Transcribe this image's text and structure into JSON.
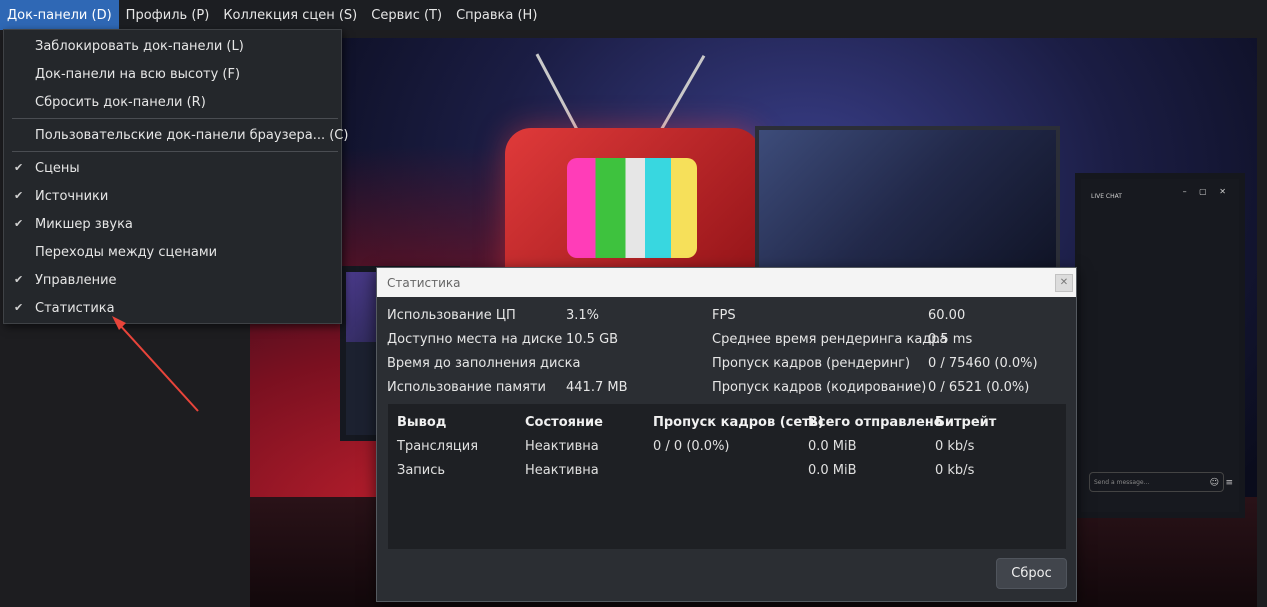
{
  "menubar": {
    "items": [
      "Док-панели (D)",
      "Профиль (P)",
      "Коллекция сцен (S)",
      "Сервис (T)",
      "Справка (H)"
    ]
  },
  "dock_menu": {
    "items": [
      {
        "label": "Заблокировать док-панели (L)",
        "checked": false
      },
      {
        "label": "Док-панели на всю высоту (F)",
        "checked": false
      },
      {
        "label": "Сбросить док-панели (R)",
        "checked": false
      },
      {
        "label": "Пользовательские док-панели браузера... (C)",
        "checked": false
      },
      {
        "label": "Сцены",
        "checked": true
      },
      {
        "label": "Источники",
        "checked": true
      },
      {
        "label": "Микшер звука",
        "checked": true
      },
      {
        "label": "Переходы между сценами",
        "checked": false
      },
      {
        "label": "Управление",
        "checked": true
      },
      {
        "label": "Статистика",
        "checked": true
      }
    ],
    "check_glyph": "✔"
  },
  "stats_dialog": {
    "title": "Статистика",
    "close_glyph": "✕",
    "left": [
      {
        "label": "Использование ЦП",
        "value": "3.1%"
      },
      {
        "label": "Доступно места на диске",
        "value": "10.5 GB"
      },
      {
        "label": "Время до заполнения диска",
        "value": ""
      },
      {
        "label": "Использование памяти",
        "value": "441.7 MB"
      }
    ],
    "right": [
      {
        "label": "FPS",
        "value": "60.00"
      },
      {
        "label": "Среднее время рендеринга кадра",
        "value": "0.5 ms"
      },
      {
        "label": "Пропуск кадров (рендеринг)",
        "value": "0 / 75460 (0.0%)"
      },
      {
        "label": "Пропуск кадров (кодирование)",
        "value": "0 / 6521 (0.0%)"
      }
    ],
    "output_table": {
      "headers": [
        "Вывод",
        "Состояние",
        "Пропуск кадров (сеть)",
        "Всего отправлено",
        "Битрейт"
      ],
      "rows": [
        [
          "Трансляция",
          "Неактивна",
          "0 / 0 (0.0%)",
          "0.0 MiB",
          "0 kb/s"
        ],
        [
          "Запись",
          "Неактивна",
          "",
          "0.0 MiB",
          "0 kb/s"
        ]
      ]
    },
    "reset_label": "Сброс"
  },
  "preview": {
    "chat_title": "LIVE CHAT",
    "chat_window_controls": "– ▢ ✕",
    "chat_placeholder": "Send a message..."
  },
  "colors": {
    "menu_active": "#2f68b5",
    "annotation_arrow": "#e8443a"
  }
}
